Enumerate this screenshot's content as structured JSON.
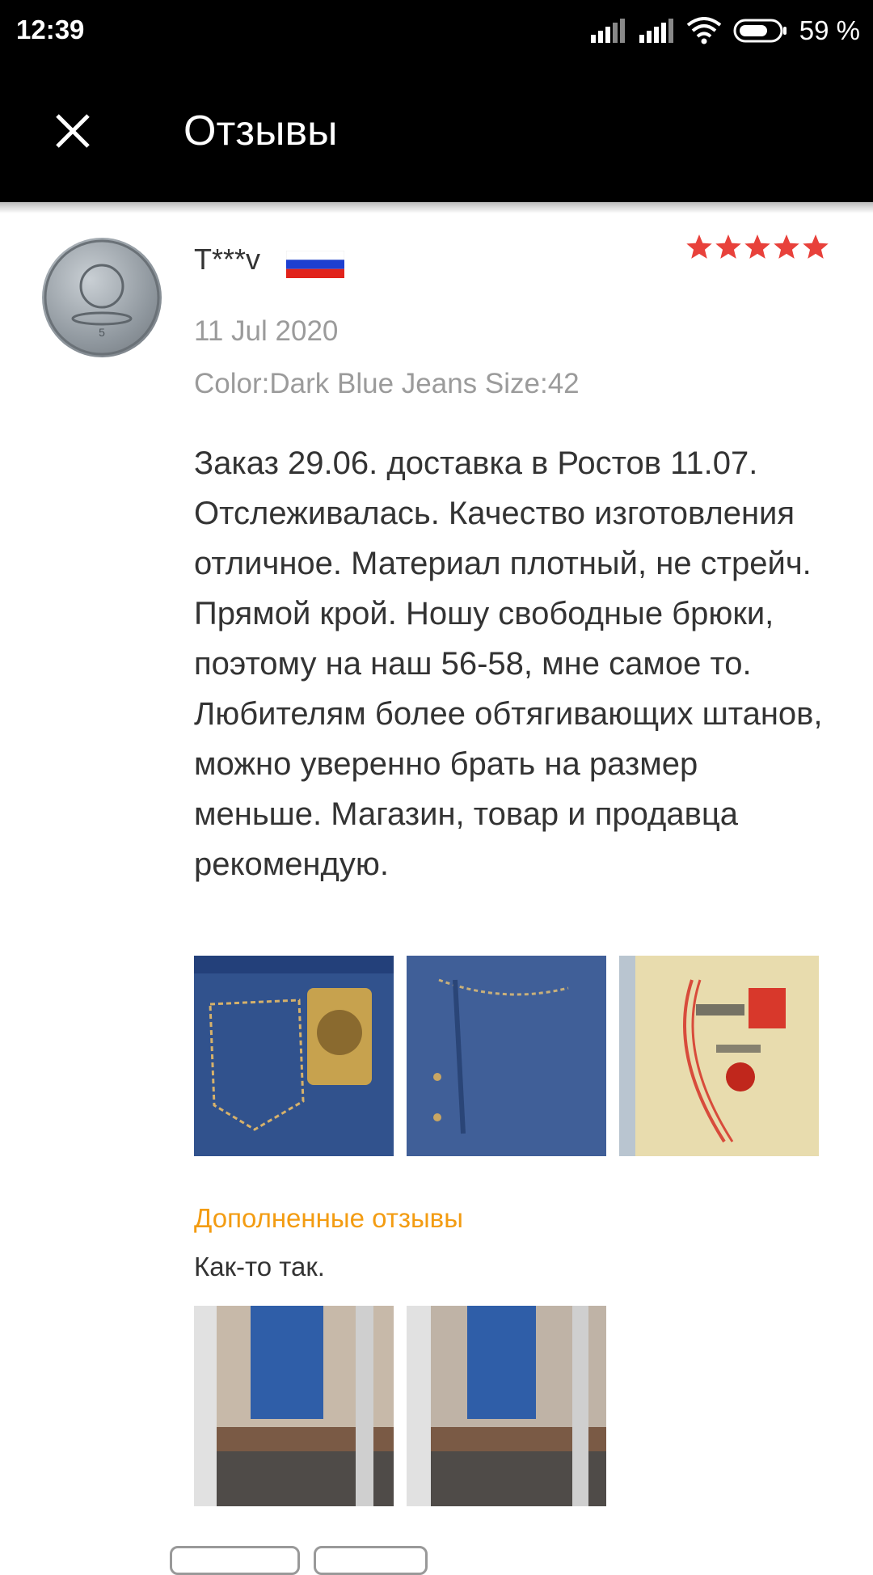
{
  "status_bar": {
    "time": "12:39",
    "battery_percent": "59 %"
  },
  "app_bar": {
    "title": "Отзывы"
  },
  "review": {
    "username": "T***v",
    "rating": 5,
    "date": "11 Jul 2020",
    "variant": "Color:Dark Blue Jeans Size:42",
    "text": "Заказ 29.06. доставка в Ростов 11.07. Отслеживалась. Качество изготовления отличное. Материал плотный, не стрейч. Прямой крой. Ношу свободные брюки, поэтому на наш 56-58, мне самое то. Любителям более обтягивающих штанов, можно уверенно брать на размер меньше. Магазин, товар и продавца рекомендую.",
    "photos": [
      "photo-jeans-back",
      "photo-jeans-front",
      "photo-package"
    ],
    "additional": {
      "title": "Дополненные отзывы",
      "text": "Как-то так.",
      "photos": [
        "photo-mirror-1",
        "photo-mirror-2"
      ]
    }
  },
  "colors": {
    "accent_orange": "#f39c12",
    "star_red": "#e8413b",
    "meta_gray": "#9b9b9b"
  }
}
